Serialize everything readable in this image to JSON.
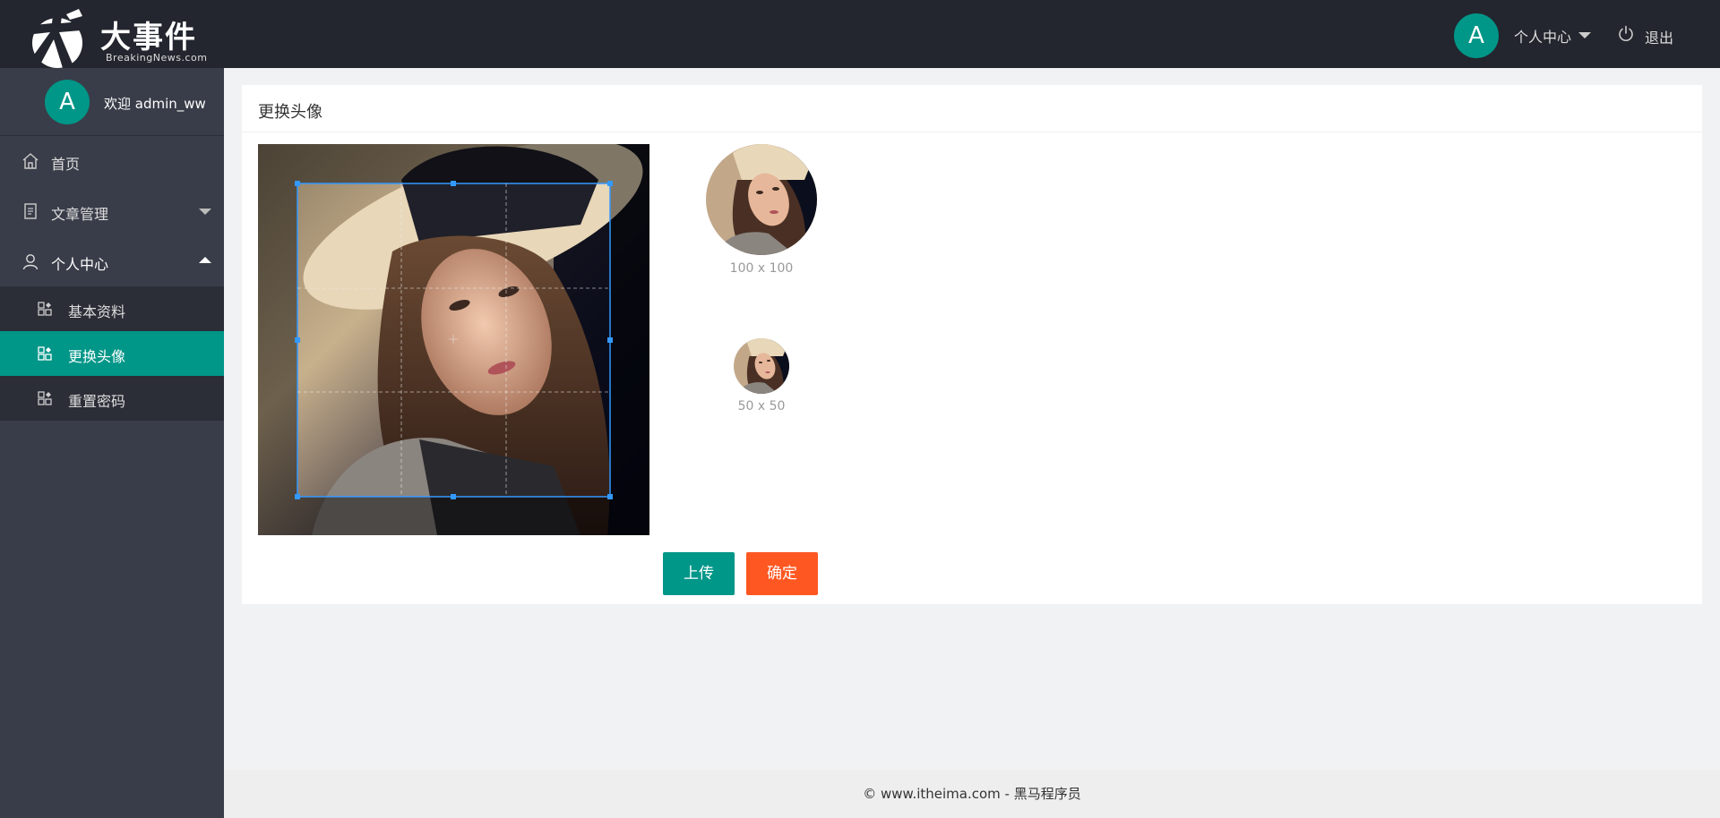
{
  "app": {
    "logo_title": "大事件",
    "logo_sub": "BreakingNews.com"
  },
  "header": {
    "avatar_letter": "A",
    "user_menu_label": "个人中心",
    "logout_label": "退出"
  },
  "sidebar": {
    "avatar_letter": "A",
    "welcome_text": "欢迎  admin_ww",
    "items": [
      {
        "label": "首页"
      },
      {
        "label": "文章管理"
      },
      {
        "label": "个人中心"
      }
    ],
    "sub_items": [
      {
        "label": "基本资料"
      },
      {
        "label": "更换头像"
      },
      {
        "label": "重置密码"
      }
    ]
  },
  "main": {
    "card_title": "更换头像",
    "preview_large_label": "100 x 100",
    "preview_small_label": "50 x 50",
    "upload_button": "上传",
    "confirm_button": "确定"
  },
  "footer": {
    "text": "© www.itheima.com - 黑马程序员"
  },
  "colors": {
    "header_bg": "#23262e",
    "sidebar_bg": "#393d49",
    "submenu_bg": "#2b2e37",
    "accent": "#009688",
    "confirm": "#ff5722"
  }
}
